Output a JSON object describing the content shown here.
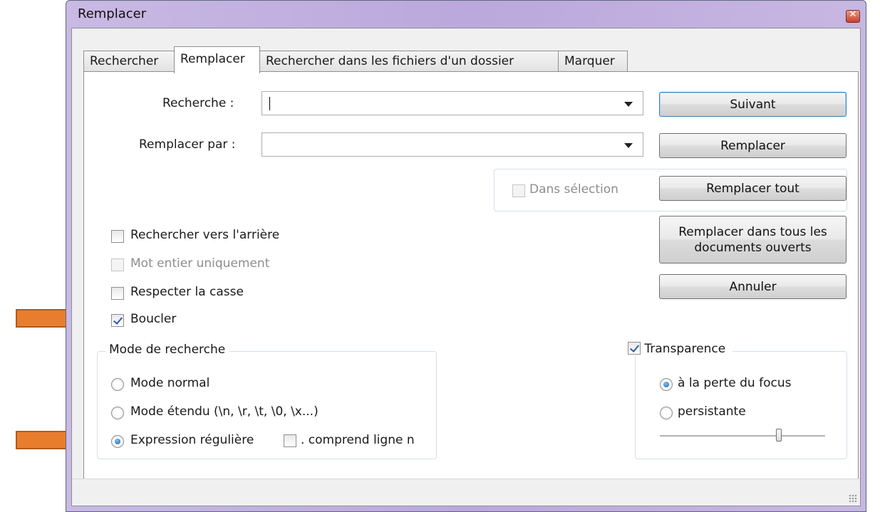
{
  "window": {
    "title": "Remplacer"
  },
  "tabs": [
    {
      "label": "Rechercher",
      "active": false
    },
    {
      "label": "Remplacer",
      "active": true
    },
    {
      "label": "Rechercher dans les fichiers d'un dossier",
      "active": false
    },
    {
      "label": "Marquer",
      "active": false
    }
  ],
  "search": {
    "label": "Recherche :",
    "value": ""
  },
  "replace": {
    "label": "Remplacer par :",
    "value": ""
  },
  "in_selection": {
    "label": "Dans sélection",
    "checked": false,
    "disabled": true
  },
  "buttons": {
    "next": "Suivant",
    "replace": "Remplacer",
    "replace_all": "Remplacer tout",
    "replace_all_docs_line1": "Remplacer dans tous les",
    "replace_all_docs_line2": "documents ouverts",
    "cancel": "Annuler"
  },
  "options": {
    "backward": {
      "label": "Rechercher vers l'arrière",
      "checked": false
    },
    "whole_word": {
      "label": "Mot entier uniquement",
      "checked": false,
      "disabled": true
    },
    "match_case": {
      "label": "Respecter la casse",
      "checked": false
    },
    "wrap": {
      "label": "Boucler",
      "checked": true
    }
  },
  "search_mode": {
    "title": "Mode de recherche",
    "normal": {
      "label": "Mode normal",
      "selected": false
    },
    "extended": {
      "label": "Mode étendu (\\n, \\r, \\t, \\0, \\x...)",
      "selected": false
    },
    "regex": {
      "label": "Expression régulière",
      "selected": true
    },
    "dot_newline": {
      "label": ". comprend ligne n",
      "checked": false
    }
  },
  "transparency": {
    "label": "Transparence",
    "checked": true,
    "on_focus_loss": {
      "label": "à la perte du focus",
      "selected": true
    },
    "always": {
      "label": "persistante",
      "selected": false
    },
    "slider_value": 0.72
  },
  "colors": {
    "annotation_arrow": "#e87d2e",
    "annotation_arrow_border": "#b35a17"
  }
}
